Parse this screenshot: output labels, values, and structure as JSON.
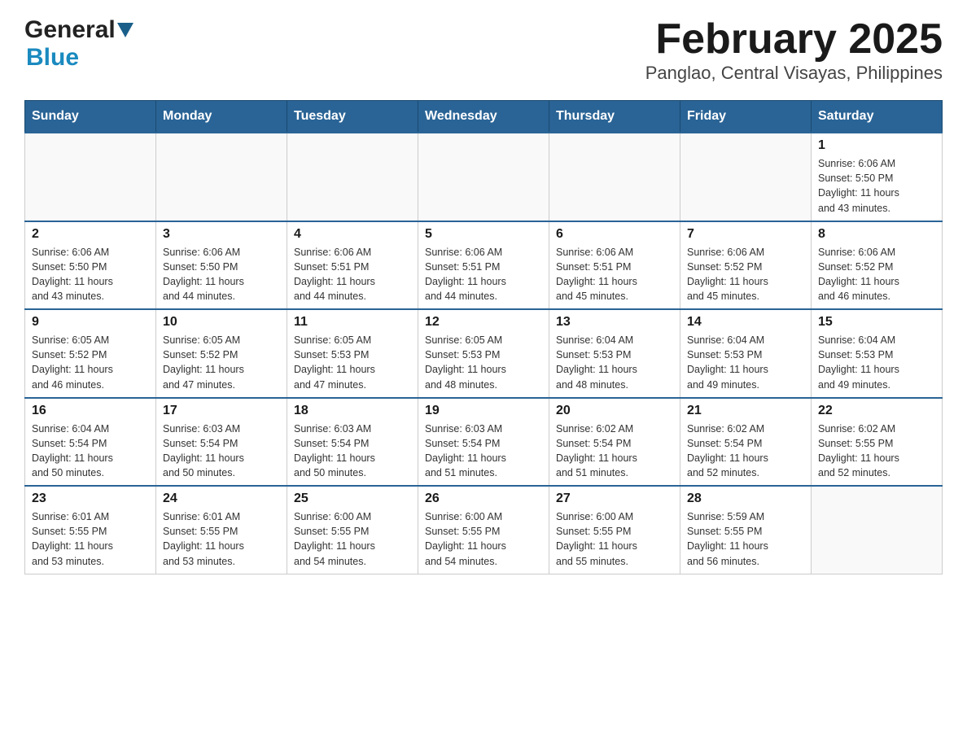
{
  "header": {
    "logo_general": "General",
    "logo_blue": "Blue",
    "title": "February 2025",
    "subtitle": "Panglao, Central Visayas, Philippines"
  },
  "calendar": {
    "days_of_week": [
      "Sunday",
      "Monday",
      "Tuesday",
      "Wednesday",
      "Thursday",
      "Friday",
      "Saturday"
    ],
    "weeks": [
      [
        {
          "day": "",
          "info": ""
        },
        {
          "day": "",
          "info": ""
        },
        {
          "day": "",
          "info": ""
        },
        {
          "day": "",
          "info": ""
        },
        {
          "day": "",
          "info": ""
        },
        {
          "day": "",
          "info": ""
        },
        {
          "day": "1",
          "info": "Sunrise: 6:06 AM\nSunset: 5:50 PM\nDaylight: 11 hours\nand 43 minutes."
        }
      ],
      [
        {
          "day": "2",
          "info": "Sunrise: 6:06 AM\nSunset: 5:50 PM\nDaylight: 11 hours\nand 43 minutes."
        },
        {
          "day": "3",
          "info": "Sunrise: 6:06 AM\nSunset: 5:50 PM\nDaylight: 11 hours\nand 44 minutes."
        },
        {
          "day": "4",
          "info": "Sunrise: 6:06 AM\nSunset: 5:51 PM\nDaylight: 11 hours\nand 44 minutes."
        },
        {
          "day": "5",
          "info": "Sunrise: 6:06 AM\nSunset: 5:51 PM\nDaylight: 11 hours\nand 44 minutes."
        },
        {
          "day": "6",
          "info": "Sunrise: 6:06 AM\nSunset: 5:51 PM\nDaylight: 11 hours\nand 45 minutes."
        },
        {
          "day": "7",
          "info": "Sunrise: 6:06 AM\nSunset: 5:52 PM\nDaylight: 11 hours\nand 45 minutes."
        },
        {
          "day": "8",
          "info": "Sunrise: 6:06 AM\nSunset: 5:52 PM\nDaylight: 11 hours\nand 46 minutes."
        }
      ],
      [
        {
          "day": "9",
          "info": "Sunrise: 6:05 AM\nSunset: 5:52 PM\nDaylight: 11 hours\nand 46 minutes."
        },
        {
          "day": "10",
          "info": "Sunrise: 6:05 AM\nSunset: 5:52 PM\nDaylight: 11 hours\nand 47 minutes."
        },
        {
          "day": "11",
          "info": "Sunrise: 6:05 AM\nSunset: 5:53 PM\nDaylight: 11 hours\nand 47 minutes."
        },
        {
          "day": "12",
          "info": "Sunrise: 6:05 AM\nSunset: 5:53 PM\nDaylight: 11 hours\nand 48 minutes."
        },
        {
          "day": "13",
          "info": "Sunrise: 6:04 AM\nSunset: 5:53 PM\nDaylight: 11 hours\nand 48 minutes."
        },
        {
          "day": "14",
          "info": "Sunrise: 6:04 AM\nSunset: 5:53 PM\nDaylight: 11 hours\nand 49 minutes."
        },
        {
          "day": "15",
          "info": "Sunrise: 6:04 AM\nSunset: 5:53 PM\nDaylight: 11 hours\nand 49 minutes."
        }
      ],
      [
        {
          "day": "16",
          "info": "Sunrise: 6:04 AM\nSunset: 5:54 PM\nDaylight: 11 hours\nand 50 minutes."
        },
        {
          "day": "17",
          "info": "Sunrise: 6:03 AM\nSunset: 5:54 PM\nDaylight: 11 hours\nand 50 minutes."
        },
        {
          "day": "18",
          "info": "Sunrise: 6:03 AM\nSunset: 5:54 PM\nDaylight: 11 hours\nand 50 minutes."
        },
        {
          "day": "19",
          "info": "Sunrise: 6:03 AM\nSunset: 5:54 PM\nDaylight: 11 hours\nand 51 minutes."
        },
        {
          "day": "20",
          "info": "Sunrise: 6:02 AM\nSunset: 5:54 PM\nDaylight: 11 hours\nand 51 minutes."
        },
        {
          "day": "21",
          "info": "Sunrise: 6:02 AM\nSunset: 5:54 PM\nDaylight: 11 hours\nand 52 minutes."
        },
        {
          "day": "22",
          "info": "Sunrise: 6:02 AM\nSunset: 5:55 PM\nDaylight: 11 hours\nand 52 minutes."
        }
      ],
      [
        {
          "day": "23",
          "info": "Sunrise: 6:01 AM\nSunset: 5:55 PM\nDaylight: 11 hours\nand 53 minutes."
        },
        {
          "day": "24",
          "info": "Sunrise: 6:01 AM\nSunset: 5:55 PM\nDaylight: 11 hours\nand 53 minutes."
        },
        {
          "day": "25",
          "info": "Sunrise: 6:00 AM\nSunset: 5:55 PM\nDaylight: 11 hours\nand 54 minutes."
        },
        {
          "day": "26",
          "info": "Sunrise: 6:00 AM\nSunset: 5:55 PM\nDaylight: 11 hours\nand 54 minutes."
        },
        {
          "day": "27",
          "info": "Sunrise: 6:00 AM\nSunset: 5:55 PM\nDaylight: 11 hours\nand 55 minutes."
        },
        {
          "day": "28",
          "info": "Sunrise: 5:59 AM\nSunset: 5:55 PM\nDaylight: 11 hours\nand 56 minutes."
        },
        {
          "day": "",
          "info": ""
        }
      ]
    ]
  }
}
